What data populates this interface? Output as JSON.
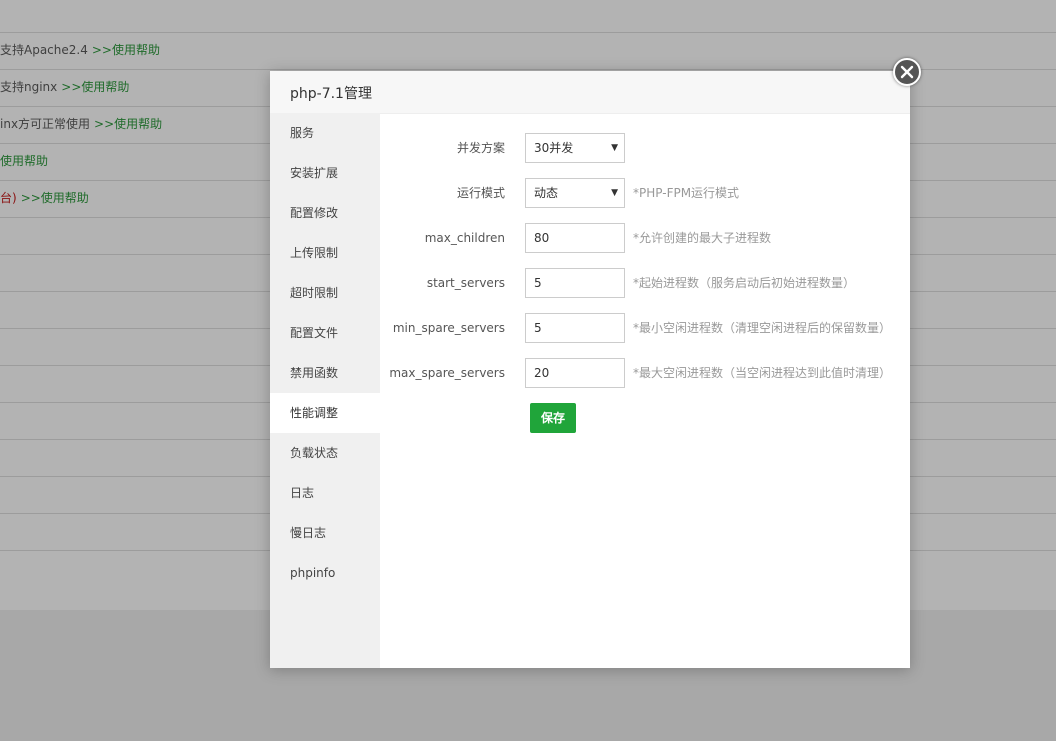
{
  "background": {
    "rows": [
      {
        "text": "支持Apache2.4",
        "link": ">>使用帮助",
        "red": ""
      },
      {
        "text": "支持nginx",
        "link": ">>使用帮助",
        "red": ""
      },
      {
        "text": "inx方可正常使用",
        "link": ">>使用帮助",
        "red": ""
      },
      {
        "text": "",
        "link": "使用帮助",
        "red": ""
      },
      {
        "text": "",
        "link": ">>使用帮助",
        "red": "台)"
      }
    ]
  },
  "modal": {
    "title": "php-7.1管理",
    "nav": [
      {
        "label": "服务"
      },
      {
        "label": "安装扩展"
      },
      {
        "label": "配置修改"
      },
      {
        "label": "上传限制"
      },
      {
        "label": "超时限制"
      },
      {
        "label": "配置文件"
      },
      {
        "label": "禁用函数"
      },
      {
        "label": "性能调整",
        "active": true
      },
      {
        "label": "负载状态"
      },
      {
        "label": "日志"
      },
      {
        "label": "慢日志"
      },
      {
        "label": "phpinfo"
      }
    ],
    "form": {
      "concurrency": {
        "label": "并发方案",
        "value": "30并发"
      },
      "run_mode": {
        "label": "运行模式",
        "value": "动态",
        "hint": "*PHP-FPM运行模式"
      },
      "max_children": {
        "label": "max_children",
        "value": "80",
        "hint": "*允许创建的最大子进程数"
      },
      "start_servers": {
        "label": "start_servers",
        "value": "5",
        "hint": "*起始进程数（服务启动后初始进程数量）"
      },
      "min_spare_servers": {
        "label": "min_spare_servers",
        "value": "5",
        "hint": "*最小空闲进程数（清理空闲进程后的保留数量）"
      },
      "max_spare_servers": {
        "label": "max_spare_servers",
        "value": "20",
        "hint": "*最大空闲进程数（当空闲进程达到此值时清理）"
      }
    },
    "save_label": "保存"
  }
}
